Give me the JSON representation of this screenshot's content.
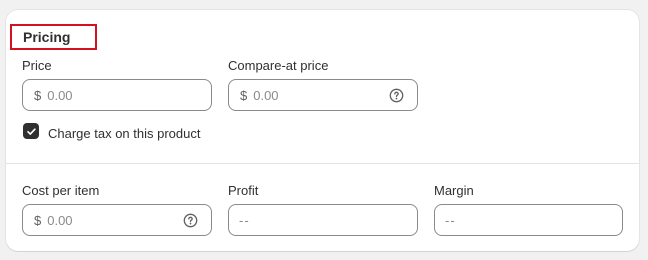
{
  "pricing": {
    "title": "Pricing",
    "price": {
      "label": "Price",
      "currency": "$",
      "value": "0.00"
    },
    "compare_at": {
      "label": "Compare-at price",
      "currency": "$",
      "value": "0.00",
      "icon": "help-icon"
    },
    "charge_tax": {
      "label": "Charge tax on this product",
      "checked": true
    },
    "cost_per_item": {
      "label": "Cost per item",
      "currency": "$",
      "value": "0.00",
      "icon": "help-icon"
    },
    "profit": {
      "label": "Profit",
      "value": "--"
    },
    "margin": {
      "label": "Margin",
      "value": "--"
    }
  },
  "colors": {
    "highlight_border": "#d4111e",
    "checkbox_fill": "#303030"
  }
}
